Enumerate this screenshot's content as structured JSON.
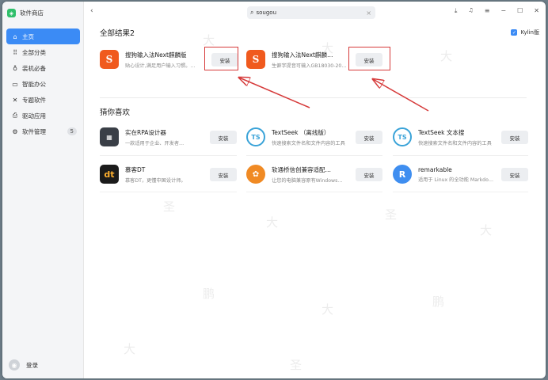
{
  "app": {
    "title": "软件商店",
    "logo_icon": "store-icon"
  },
  "sidebar": {
    "items": [
      {
        "label": "主页",
        "icon": "home-icon",
        "active": true
      },
      {
        "label": "全部分类",
        "icon": "grid-icon"
      },
      {
        "label": "装机必备",
        "icon": "package-icon"
      },
      {
        "label": "智能办公",
        "icon": "monitor-icon"
      },
      {
        "label": "专题软件",
        "icon": "topic-icon"
      },
      {
        "label": "驱动应用",
        "icon": "driver-icon"
      },
      {
        "label": "软件管理",
        "icon": "settings-icon",
        "badge": "5"
      }
    ],
    "login_label": "登录"
  },
  "topbar": {
    "back": "‹",
    "search_value": "sougou",
    "search_clear": "×",
    "ctrls": [
      "⤓",
      "🔔",
      "≡",
      "−",
      "☐",
      "✕"
    ]
  },
  "results": {
    "title": "全部结果2",
    "filter_label": "Kylin版",
    "cards": [
      {
        "name": "搜狗输入法Next麒麟版",
        "desc": "贴心设计,满足用户输入习惯。...",
        "button": "安装",
        "icon": "sogou-icon",
        "glyph": "S"
      },
      {
        "name": "搜狗输入法Next麒麟…",
        "desc": "生僻字提音可输入GB18030-20…",
        "button": "安装",
        "icon": "sogou-icon",
        "glyph": "S"
      }
    ]
  },
  "guess": {
    "title": "猜你喜欢",
    "cards": [
      {
        "name": "实在RPA设计器",
        "desc": "一款适用于企业、开发者…",
        "button": "安装",
        "icon": "rpa-icon",
        "glyph": "▦"
      },
      {
        "name": "TextSeek （离线版）",
        "desc": "快速搜索文件名和文件内容的工具",
        "button": "安装",
        "icon": "textseek-icon",
        "glyph": "TS"
      },
      {
        "name": "TextSeek 文本搜",
        "desc": "快速搜索文件名和文件内容的工具",
        "button": "安装",
        "icon": "textseek-icon",
        "glyph": "TS"
      },
      {
        "name": "慕客DT",
        "desc": "慕客DT，更懂中国设计师。",
        "button": "安装",
        "icon": "dt-icon",
        "glyph": "dt"
      },
      {
        "name": "软通桥信创兼容适配…",
        "desc": "让您的电脑兼容原有Windows…",
        "button": "安装",
        "icon": "kylin-bridge-icon",
        "glyph": "✿"
      },
      {
        "name": "remarkable",
        "desc": "适用于 Linux 的全功能 Markdo…",
        "button": "安装",
        "icon": "remarkable-icon",
        "glyph": "R"
      }
    ]
  },
  "colors": {
    "accent": "#3b8bf5",
    "annotation": "#d63a3a"
  }
}
